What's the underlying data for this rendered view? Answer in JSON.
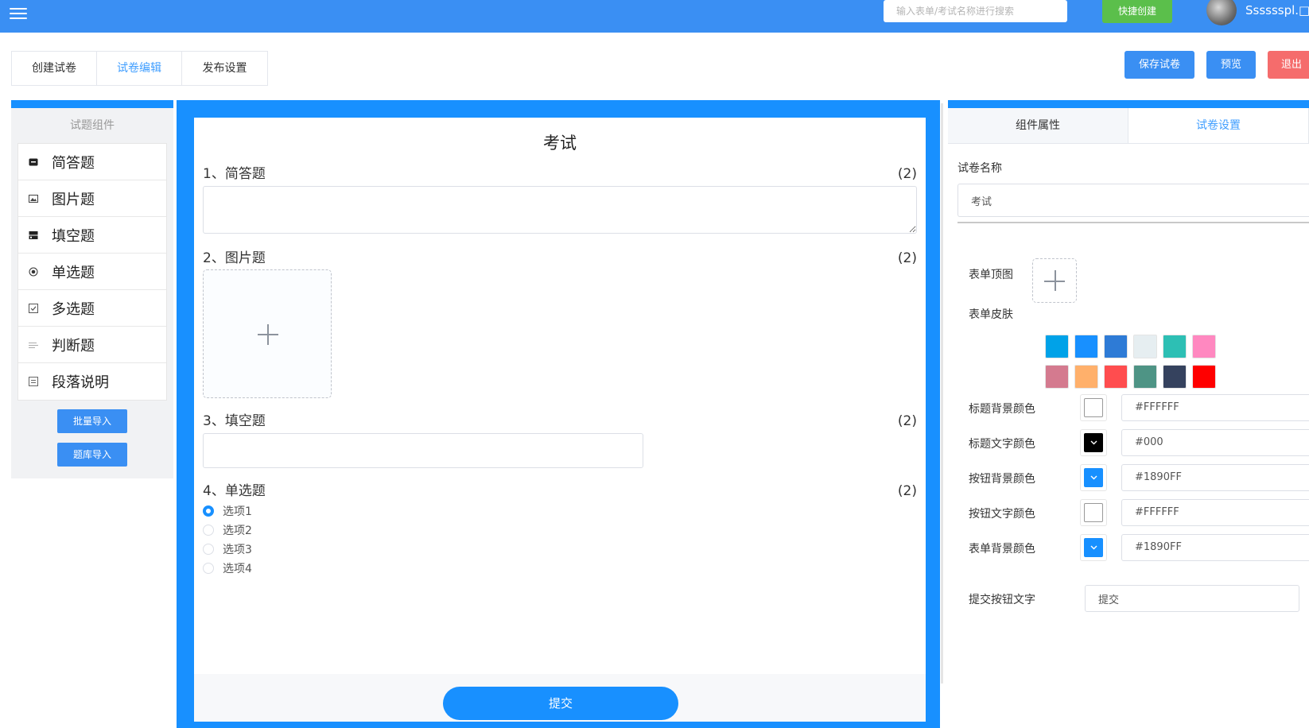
{
  "header": {
    "search_placeholder": "输入表单/考试名称进行搜索",
    "quick_create": "快捷创建",
    "username": "Sssssspl.□"
  },
  "tabs": [
    {
      "label": "创建试卷",
      "active": false
    },
    {
      "label": "试卷编辑",
      "active": true
    },
    {
      "label": "发布设置",
      "active": false
    }
  ],
  "actions": {
    "save": "保存试卷",
    "preview": "预览",
    "exit": "退出"
  },
  "left_panel": {
    "title": "试题组件",
    "components": [
      {
        "label": "简答题",
        "icon": "short-answer-icon"
      },
      {
        "label": "图片题",
        "icon": "image-icon"
      },
      {
        "label": "填空题",
        "icon": "fill-blank-icon"
      },
      {
        "label": "单选题",
        "icon": "radio-icon"
      },
      {
        "label": "多选题",
        "icon": "checkbox-icon"
      },
      {
        "label": "判断题",
        "icon": "judge-icon"
      },
      {
        "label": "段落说明",
        "icon": "paragraph-icon"
      }
    ],
    "batch_import": "批量导入",
    "bank_import": "题库导入"
  },
  "paper": {
    "title": "考试",
    "questions": [
      {
        "title": "1、简答题",
        "score": "(2)"
      },
      {
        "title": "2、图片题",
        "score": "(2)"
      },
      {
        "title": "3、填空题",
        "score": "(2)"
      },
      {
        "title": "4、单选题",
        "score": "(2)",
        "options": [
          "选项1",
          "选项2",
          "选项3",
          "选项4"
        ],
        "selected": 0
      }
    ],
    "submit": "提交"
  },
  "right_panel": {
    "tabs": [
      {
        "label": "组件属性",
        "active": false
      },
      {
        "label": "试卷设置",
        "active": true
      }
    ],
    "paper_name_label": "试卷名称",
    "paper_name_value": "考试",
    "top_image_label": "表单顶图",
    "skin_label": "表单皮肤",
    "skins": [
      "#00a2e8",
      "#1890ff",
      "#2e7bd6",
      "#e6eef1",
      "#2dbfb4",
      "#ff88c0",
      "#d47a8f",
      "#ffb06b",
      "#ff4d4f",
      "#4e9485",
      "#35425e",
      "#ff0000"
    ],
    "colors": [
      {
        "label": "标题背景颜色",
        "value": "#FFFFFF",
        "swatch": "#ffffff"
      },
      {
        "label": "标题文字颜色",
        "value": "#000",
        "swatch": "#000000"
      },
      {
        "label": "按钮背景颜色",
        "value": "#1890FF",
        "swatch": "#1890ff"
      },
      {
        "label": "按钮文字颜色",
        "value": "#FFFFFF",
        "swatch": "#ffffff"
      },
      {
        "label": "表单背景颜色",
        "value": "#1890FF",
        "swatch": "#1890ff"
      }
    ],
    "submit_text_label": "提交按钮文字",
    "submit_text_value": "提交"
  }
}
